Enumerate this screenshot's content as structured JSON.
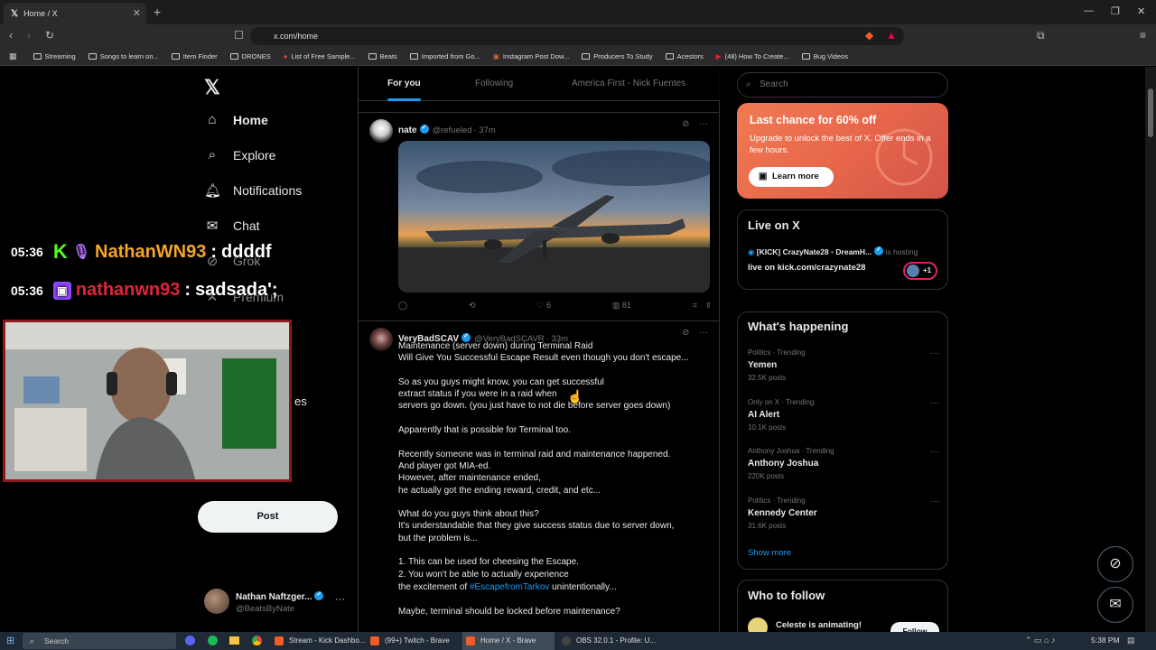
{
  "browser": {
    "tab_title": "Home / X",
    "url": "x.com/home",
    "bookmarks": [
      "Streaming",
      "Songs to learn on...",
      "Item Finder",
      "DRONES",
      "List of Free Sample...",
      "Beats",
      "Imported from Go...",
      "Instagram Post Dow...",
      "Producers To Study",
      "Acestors",
      "(48) How To Create...",
      "Bug Videos"
    ]
  },
  "nav": {
    "home": "Home",
    "explore": "Explore",
    "notifications": "Notifications",
    "chat": "Chat",
    "grok": "Grok",
    "premium": "Premium",
    "partial_es": "es",
    "post_button": "Post",
    "profile_name": "Nathan Naftzger...",
    "profile_handle": "@BeatsByNate"
  },
  "overlay": {
    "chat1_time": "05:36",
    "chat1_user": "NathanWN93",
    "chat1_msg": "ddddf",
    "chat2_time": "05:36",
    "chat2_user": "nathanwn93",
    "chat2_msg": "sadsada';"
  },
  "feed": {
    "tabs": [
      "For you",
      "Following",
      "America First - Nick Fuentes"
    ],
    "tweet1": {
      "name": "nate",
      "handle": "@refueled",
      "time": "· 37m",
      "likes": "6",
      "views": "81"
    },
    "tweet2": {
      "name": "VeryBadSCAV",
      "handle": "@VeryBadSCAVR",
      "time": "· 33m",
      "lines": [
        "Maintenance (server down) during Terminal Raid",
        "Will Give You Successful Escape Result even though you don't escape...",
        "",
        "So as you guys might know, you can get successful",
        "extract status if you were in a raid when",
        "servers go down. (you just have to not die before server goes down)",
        "",
        "Apparently that is possible for Terminal too.",
        "",
        "Recently someone was in terminal raid and maintenance happened.",
        "And player got MIA-ed.",
        "However, after maintenance ended,",
        "he actually got the ending reward, credit, and etc...",
        "",
        "What do you guys think about this?",
        "It's understandable that they give success status due to server down,",
        "but the problem is...",
        "",
        "1. This can be used for cheesing the Escape.",
        "2. You won't be able to actually experience"
      ],
      "line_pre": "the excitement of",
      "hashtag": "#EscapefromTarkov",
      "line_post": "unintentionally...",
      "last_line": "Maybe, terminal should be locked before maintenance?"
    }
  },
  "sidebar": {
    "search_placeholder": "Search",
    "promo_title": "Last chance for 60% off",
    "promo_text": "Upgrade to unlock the best of X. Offer ends in a few hours.",
    "promo_button": "Learn more",
    "live_title": "Live on X",
    "live_host": "[KICK] CrazyNate28",
    "live_cohost": "DreamH...",
    "live_status": "is hosting",
    "live_text": "live on kick.com/crazynate28",
    "live_plus": "+1",
    "happening_title": "What's happening",
    "trends": [
      {
        "meta": "Politics · Trending",
        "title": "Yemen",
        "count": "32.5K posts"
      },
      {
        "meta": "Only on X · Trending",
        "title": "AI Alert",
        "count": "10.1K posts"
      },
      {
        "meta": "Anthony Joshua · Trending",
        "title": "Anthony Joshua",
        "count": "220K posts"
      },
      {
        "meta": "Politics · Trending",
        "title": "Kennedy Center",
        "count": "31.6K posts"
      }
    ],
    "show_more": "Show more",
    "follow_title": "Who to follow",
    "follow_name": "Celeste is animating!",
    "follow_button": "Follow"
  },
  "taskbar": {
    "search": "Search",
    "apps": [
      "Stream - Kick Dashbo...",
      "(99+) Twitch - Brave",
      "Home / X - Brave",
      "OBS 32.0.1 - Profile: U..."
    ],
    "time": "5:38 PM"
  },
  "colors": {
    "accent": "#1d9bf0",
    "promo": "#e8674b",
    "kick": "#53fc18",
    "twitch": "#9146ff"
  }
}
